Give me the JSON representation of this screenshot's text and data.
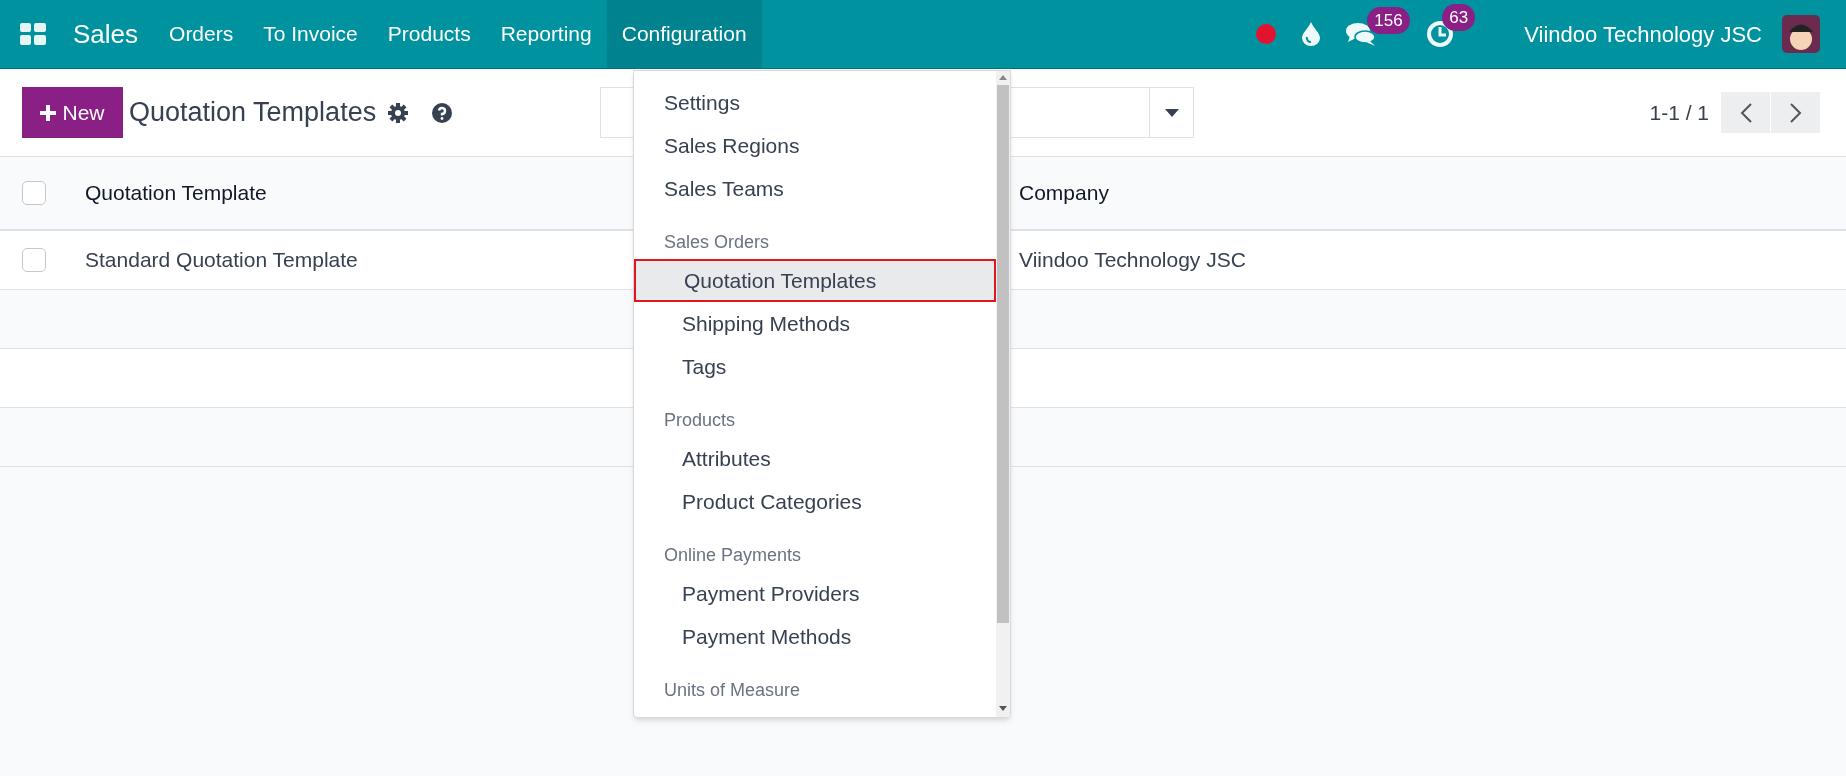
{
  "navbar": {
    "app": "Sales",
    "menus": [
      {
        "label": "Orders",
        "selected": false
      },
      {
        "label": "To Invoice",
        "selected": false
      },
      {
        "label": "Products",
        "selected": false
      },
      {
        "label": "Reporting",
        "selected": false
      },
      {
        "label": "Configuration",
        "selected": true
      }
    ],
    "messages_count": "156",
    "activities_count": "63",
    "company": "Viindoo Technology JSC"
  },
  "control_panel": {
    "new_button": "New",
    "title": "Quotation Templates",
    "pager": "1-1 / 1"
  },
  "table": {
    "select_all_checked": false,
    "columns": [
      "Quotation Template",
      "Company"
    ],
    "rows": [
      {
        "cells": [
          "Standard Quotation Template",
          "Viindoo Technology JSC"
        ],
        "checked": false
      }
    ]
  },
  "dropdown": {
    "items": [
      {
        "kind": "item",
        "label": "Settings",
        "selected": false
      },
      {
        "kind": "item",
        "label": "Sales Regions",
        "selected": false
      },
      {
        "kind": "item",
        "label": "Sales Teams",
        "selected": false
      },
      {
        "kind": "header",
        "label": "Sales Orders"
      },
      {
        "kind": "subitem",
        "label": "Quotation Templates",
        "selected": true
      },
      {
        "kind": "subitem",
        "label": "Shipping Methods",
        "selected": false
      },
      {
        "kind": "subitem",
        "label": "Tags",
        "selected": false
      },
      {
        "kind": "header",
        "label": "Products"
      },
      {
        "kind": "subitem",
        "label": "Attributes",
        "selected": false
      },
      {
        "kind": "subitem",
        "label": "Product Categories",
        "selected": false
      },
      {
        "kind": "header",
        "label": "Online Payments"
      },
      {
        "kind": "subitem",
        "label": "Payment Providers",
        "selected": false
      },
      {
        "kind": "subitem",
        "label": "Payment Methods",
        "selected": false
      },
      {
        "kind": "header",
        "label": "Units of Measure"
      }
    ]
  }
}
